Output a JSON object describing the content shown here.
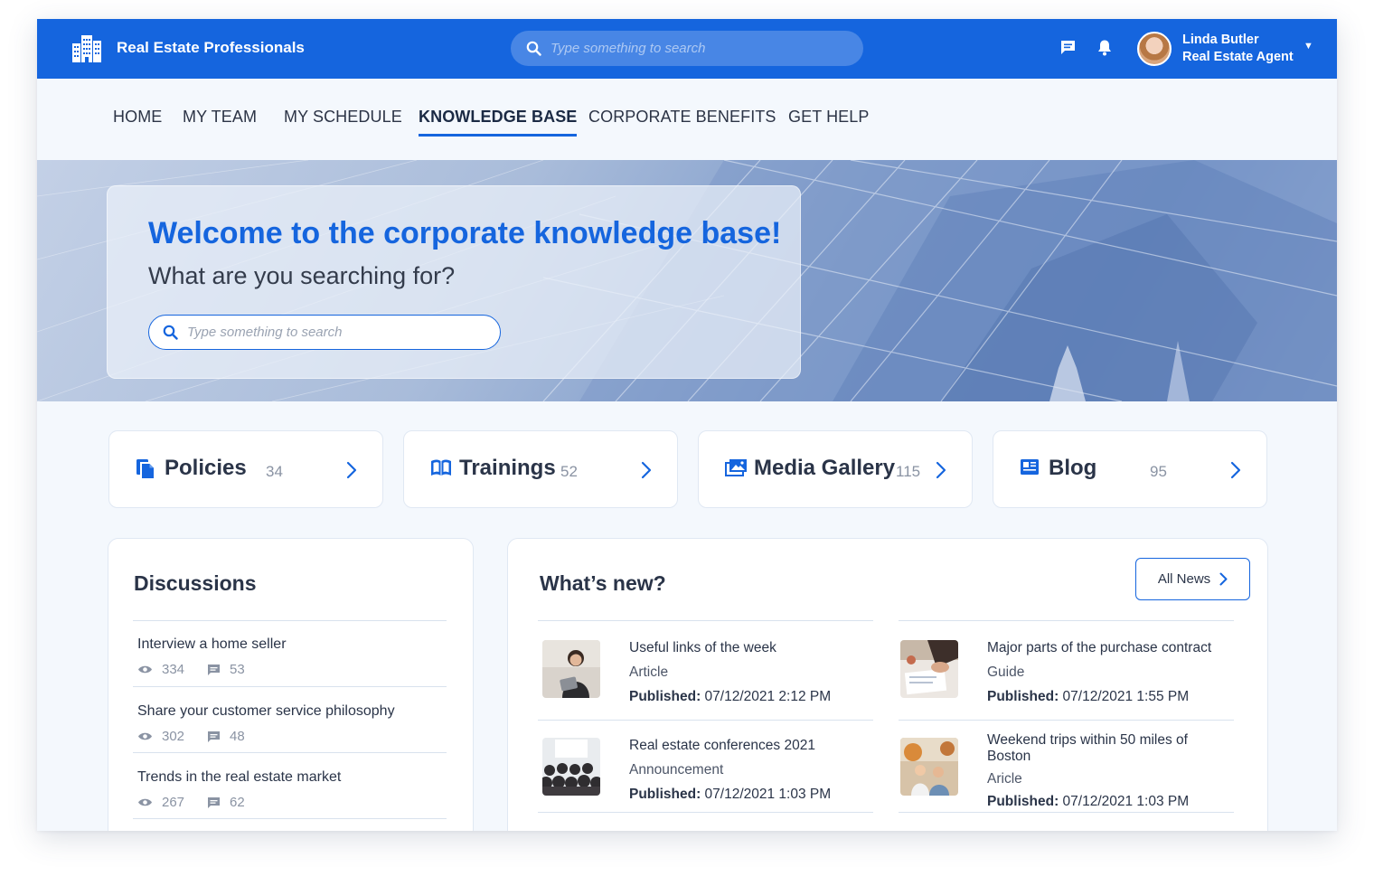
{
  "app": {
    "brand": "Real Estate Professionals",
    "search_placeholder": "Type something to search",
    "user": {
      "name": "Linda Butler",
      "role": "Real Estate Agent"
    }
  },
  "nav": {
    "items": [
      {
        "label": "HOME",
        "active": false
      },
      {
        "label": "MY TEAM",
        "active": false
      },
      {
        "label": "MY SCHEDULE",
        "active": false
      },
      {
        "label": "KNOWLEDGE BASE",
        "active": true
      },
      {
        "label": "CORPORATE BENEFITS",
        "active": false
      },
      {
        "label": "GET HELP",
        "active": false
      }
    ]
  },
  "hero": {
    "title": "Welcome to the corporate knowledge base!",
    "subtitle": "What are you searching for?",
    "search_placeholder": "Type something to search"
  },
  "categories": [
    {
      "title": "Policies",
      "count": "34",
      "icon": "documents-icon"
    },
    {
      "title": "Trainings",
      "count": "52",
      "icon": "book-icon"
    },
    {
      "title": "Media Gallery",
      "count": "115",
      "icon": "photo-gallery-icon"
    },
    {
      "title": "Blog",
      "count": "95",
      "icon": "newspaper-icon"
    }
  ],
  "discussions": {
    "title": "Discussions",
    "items": [
      {
        "title": "Interview a home seller",
        "views": "334",
        "comments": "53"
      },
      {
        "title": "Share your customer service philosophy",
        "views": "302",
        "comments": "48"
      },
      {
        "title": "Trends in the real estate market",
        "views": "267",
        "comments": "62"
      }
    ]
  },
  "whats_new": {
    "title": "What’s new?",
    "all_news_label": "All News",
    "published_label": "Published:",
    "items": [
      {
        "title": "Useful links of the week",
        "type": "Article",
        "published": "07/12/2021 2:12 PM"
      },
      {
        "title": "Major parts of the purchase contract",
        "type": "Guide",
        "published": "07/12/2021 1:55 PM"
      },
      {
        "title": "Real estate conferences 2021",
        "type": "Announcement",
        "published": "07/12/2021 1:03 PM"
      },
      {
        "title": "Weekend trips within 50 miles of Boston",
        "type": "Aricle",
        "published": "07/12/2021 1:03 PM"
      }
    ]
  },
  "colors": {
    "primary": "#1565de",
    "text": "#2a3448",
    "muted": "#8a93a3",
    "background": "#f4f8fd"
  }
}
